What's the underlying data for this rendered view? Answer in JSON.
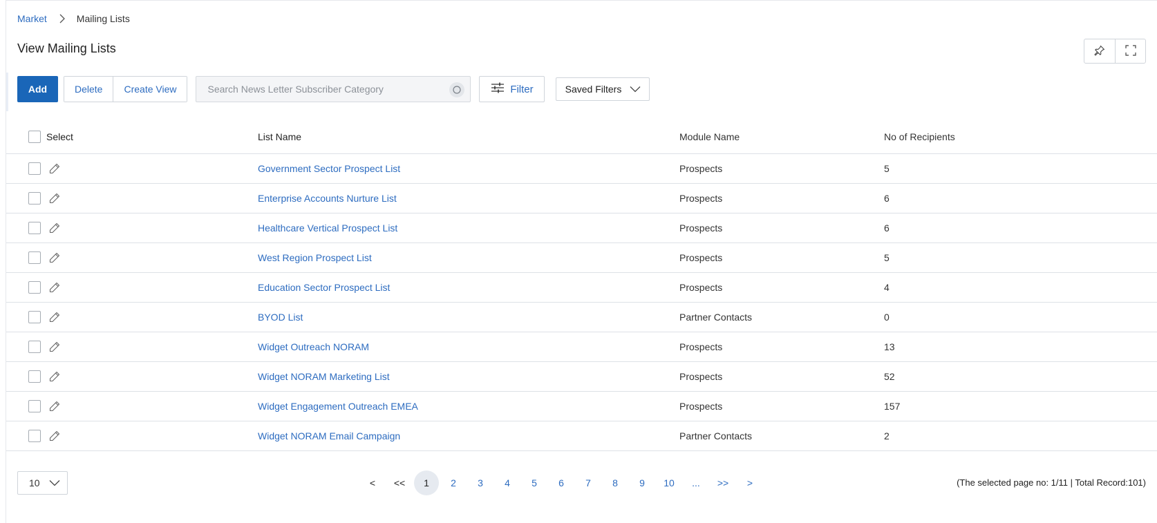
{
  "breadcrumb": {
    "parent": "Market",
    "current": "Mailing Lists"
  },
  "page": {
    "title": "View Mailing Lists"
  },
  "corner_tools": {
    "pin_icon": "pin-icon",
    "expand_icon": "fullscreen-icon"
  },
  "toolbar": {
    "add_label": "Add",
    "delete_label": "Delete",
    "create_view_label": "Create View",
    "search_placeholder": "Search News Letter Subscriber Category",
    "search_value": "",
    "filter_label": "Filter",
    "saved_filters_label": "Saved Filters"
  },
  "table": {
    "headers": {
      "select": "Select",
      "list_name": "List Name",
      "module_name": "Module Name",
      "recipients": "No of Recipients"
    },
    "rows": [
      {
        "name": "Government Sector Prospect List",
        "module": "Prospects",
        "count": "5"
      },
      {
        "name": "Enterprise Accounts Nurture List",
        "module": "Prospects",
        "count": "6"
      },
      {
        "name": "Healthcare Vertical Prospect List",
        "module": "Prospects",
        "count": "6"
      },
      {
        "name": "West Region Prospect List",
        "module": "Prospects",
        "count": "5"
      },
      {
        "name": "Education Sector Prospect List",
        "module": "Prospects",
        "count": "4"
      },
      {
        "name": "BYOD List",
        "module": "Partner Contacts",
        "count": "0"
      },
      {
        "name": "Widget Outreach NORAM",
        "module": "Prospects",
        "count": "13"
      },
      {
        "name": "Widget NORAM Marketing List",
        "module": "Prospects",
        "count": "52"
      },
      {
        "name": "Widget Engagement Outreach EMEA",
        "module": "Prospects",
        "count": "157"
      },
      {
        "name": "Widget NORAM Email Campaign",
        "module": "Partner Contacts",
        "count": "2"
      }
    ]
  },
  "pagination": {
    "page_size": "10",
    "prev": "<",
    "first": "<<",
    "pages": [
      "1",
      "2",
      "3",
      "4",
      "5",
      "6",
      "7",
      "8",
      "9",
      "10"
    ],
    "current_page": "1",
    "ellipsis": "...",
    "last": ">>",
    "next": ">",
    "summary": "(The selected page no: 1/11 | Total Record:101)"
  },
  "colors": {
    "primary": "#1a66b8",
    "link": "#2d6cc0",
    "border": "#cfd4da",
    "row_divider": "#dde1e6"
  }
}
